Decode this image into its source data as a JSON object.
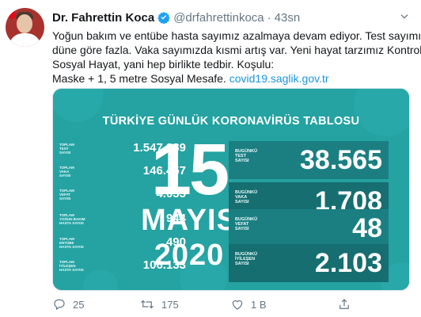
{
  "author": {
    "name": "Dr. Fahrettin Koca",
    "handle": "@drfahrettinkoca",
    "separator": "·",
    "time": "43sn",
    "verified_icon": "verified-badge-icon",
    "avatar": "avatar"
  },
  "tweet": {
    "lines": [
      "Yoğun bakım ve entübe hasta sayımız azalmaya devam ediyor. Test sayımız",
      "düne göre fazla. Vaka sayımızda kısmi artış var. Yeni hayat tarzımız Kontrollü",
      "Sosyal Hayat, yani hep birlikte tedbir. Koşulu:"
    ],
    "last_line_text": "Maske + 1, 5 metre Sosyal Mesafe.",
    "link": "covid19.saglik.gov.tr"
  },
  "card": {
    "title": "TÜRKİYE GÜNLÜK KORONAVİRÜS TABLOSU",
    "day": "15",
    "month": "MAYIS",
    "year": "2020",
    "colors": {
      "background": "#25a2a2",
      "panel": "#1b7f82",
      "text": "#ffffff"
    },
    "totals": [
      {
        "label": [
          "TOPLAM",
          "TEST",
          "SAYISI"
        ],
        "value": "1.547.389"
      },
      {
        "label": [
          "TOPLAM",
          "VAKA",
          "SAYISI"
        ],
        "value": "146.457"
      },
      {
        "label": [
          "TOPLAM",
          "VEFAT",
          "SAYISI"
        ],
        "value": "4.055"
      },
      {
        "label": [
          "TOPLAM",
          "YOĞUN BAKIM",
          "HASTA SAYISI"
        ],
        "value": "944"
      },
      {
        "label": [
          "TOPLAM",
          "ENTÜBE",
          "HASTA SAYISI"
        ],
        "value": "490"
      },
      {
        "label": [
          "TOPLAM",
          "İYİLEŞEN",
          "HASTA SAYISI"
        ],
        "value": "106.133"
      }
    ],
    "today": [
      {
        "label": [
          "BUGÜNKÜ",
          "TEST",
          "SAYISI"
        ],
        "value": "38.565"
      },
      {
        "label": [
          "BUGÜNKÜ",
          "VAKA",
          "SAYISI"
        ],
        "value": "1.708"
      },
      {
        "label": [
          "BUGÜNKÜ",
          "VEFAT",
          "SAYISI"
        ],
        "value": "48"
      },
      {
        "label": [
          "BUGÜNKÜ",
          "İYİLEŞEN",
          "SAYISI"
        ],
        "value": "2.103"
      }
    ]
  },
  "actions": {
    "reply_count": "25",
    "retweet_count": "175",
    "like_count": "1 B",
    "icons": [
      "reply-icon",
      "retweet-icon",
      "like-icon",
      "share-icon"
    ]
  }
}
